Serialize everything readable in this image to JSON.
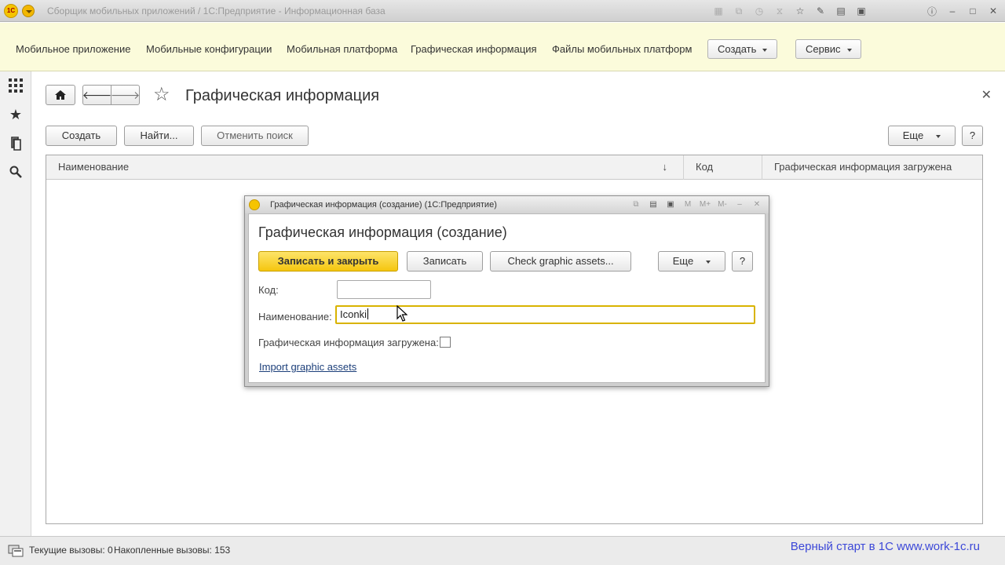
{
  "window": {
    "title": "Сборщик мобильных приложений / 1С:Предприятие - Информационная база"
  },
  "sections": {
    "items": [
      "Мобильное приложение",
      "Мобильные конфигурации",
      "Мобильная платформа",
      "Графическая информация",
      "Файлы мобильных платформ"
    ],
    "create_label": "Создать",
    "service_label": "Сервис"
  },
  "form": {
    "title": "Графическая информация",
    "buttons": {
      "create": "Создать",
      "find": "Найти...",
      "cancel_search": "Отменить поиск",
      "more": "Еще",
      "help": "?"
    },
    "table": {
      "columns": [
        "Наименование",
        "Код",
        "Графическая информация загружена"
      ],
      "sort_indicator": "↓",
      "rows": []
    }
  },
  "dialog": {
    "caption": "Графическая информация (создание)  (1С:Предприятие)",
    "heading": "Графическая информация (создание)",
    "buttons": {
      "save_close": "Записать и закрыть",
      "save": "Записать",
      "check": "Check graphic assets...",
      "more": "Еще",
      "help": "?"
    },
    "fields": {
      "code_label": "Код:",
      "code_value": "",
      "name_label": "Наименование:",
      "name_value": "Iconki",
      "loaded_label": "Графическая информация загружена:",
      "loaded_checked": false
    },
    "link": "Import graphic assets"
  },
  "statusbar": {
    "current_calls": "Текущие вызовы: 0",
    "accumulated_calls": "Накопленные вызовы: 153",
    "watermark": "Верный старт  в 1С www.work-1c.ru"
  },
  "colors": {
    "sections_bg": "#fbfbdb",
    "primary_button": "#f5c60f",
    "focus_border": "#d9b300",
    "link": "#1c3f7a",
    "watermark": "#3c48d8"
  }
}
